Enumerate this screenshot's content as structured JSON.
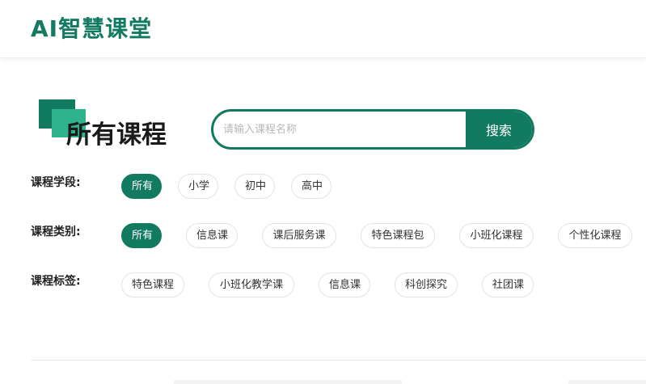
{
  "header": {
    "logo": "AI智慧课堂"
  },
  "main": {
    "title": "所有课程",
    "search": {
      "placeholder": "请输入课程名称",
      "value": "",
      "button_label": "搜索"
    }
  },
  "filters": {
    "stage": {
      "label": "课程学段:",
      "options": [
        "所有",
        "小学",
        "初中",
        "高中"
      ],
      "selected": "所有"
    },
    "category": {
      "label": "课程类别:",
      "options": [
        "所有",
        "信息课",
        "课后服务课",
        "特色课程包",
        "小班化课程",
        "个性化课程"
      ],
      "selected": "所有"
    },
    "tag": {
      "label": "课程标签:",
      "options": [
        "特色课程",
        "小班化教学课",
        "信息课",
        "科创探究",
        "社团课"
      ]
    }
  },
  "colors": {
    "brand": "#137a62",
    "brand_light": "#2fb38f"
  }
}
